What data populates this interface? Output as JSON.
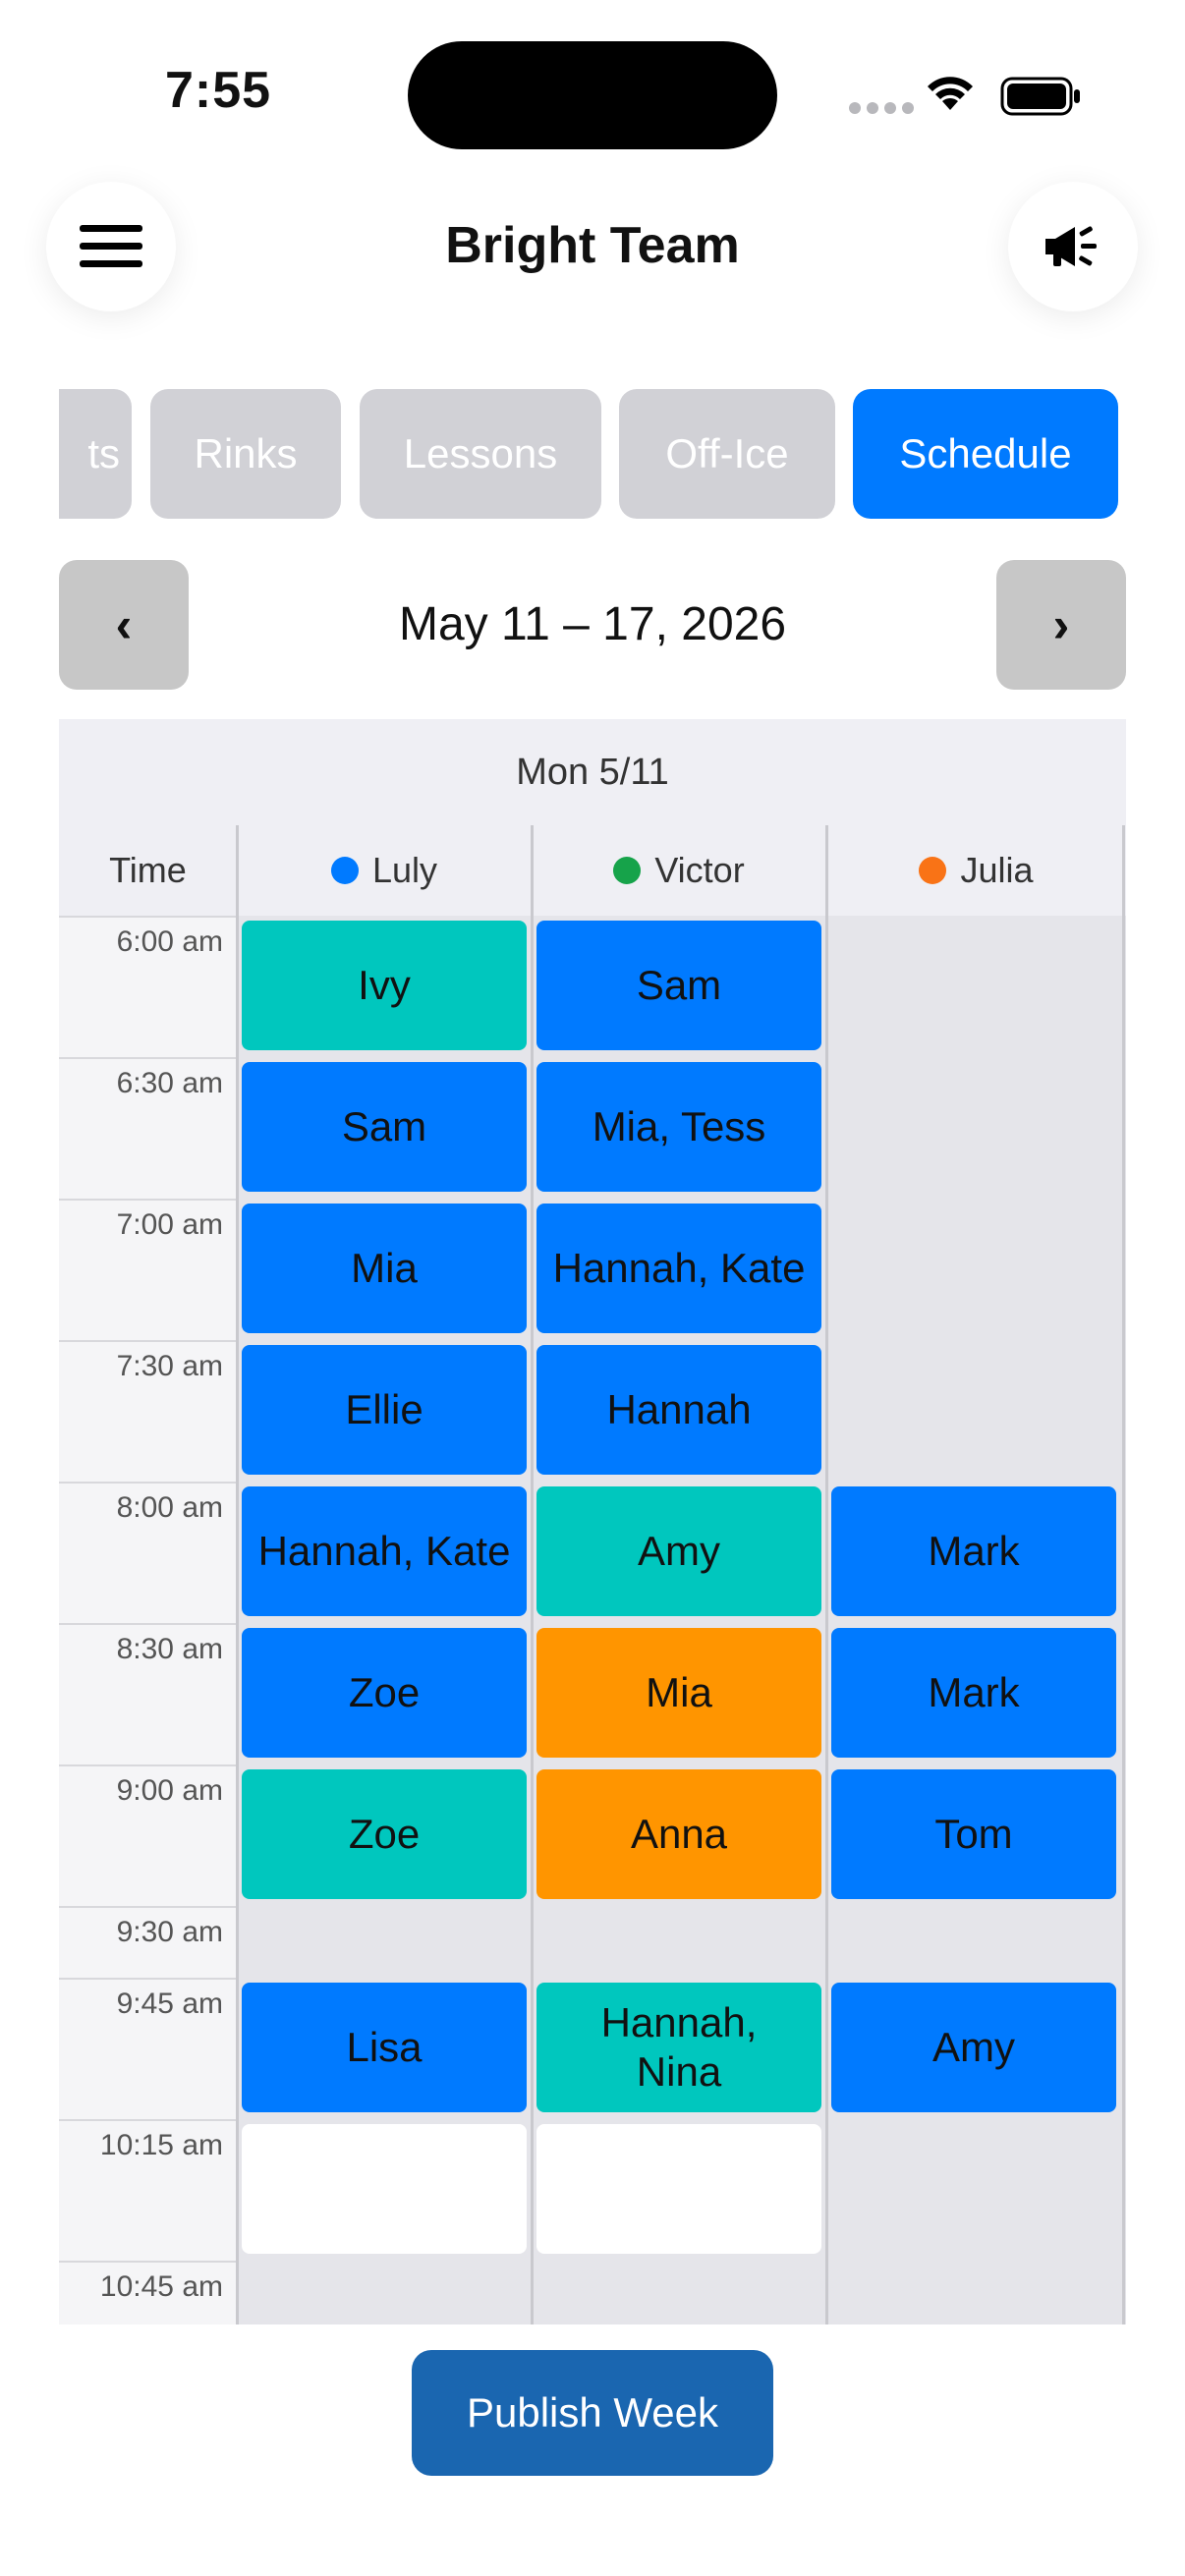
{
  "status_bar": {
    "time": "7:55"
  },
  "header": {
    "title": "Bright Team",
    "menu_icon": "hamburger-icon",
    "announce_icon": "megaphone-icon"
  },
  "tabs": [
    {
      "label": "ts",
      "active": false
    },
    {
      "label": "Rinks",
      "active": false
    },
    {
      "label": "Lessons",
      "active": false
    },
    {
      "label": "Off-Ice",
      "active": false
    },
    {
      "label": "Schedule",
      "active": true
    }
  ],
  "week_nav": {
    "prev_label": "‹",
    "next_label": "›",
    "range": "May 11 – 17, 2026"
  },
  "schedule": {
    "day_label": "Mon 5/11",
    "time_header": "Time",
    "coaches": [
      {
        "name": "Luly",
        "color": "#007aff"
      },
      {
        "name": "Victor",
        "color": "#16a34a"
      },
      {
        "name": "Julia",
        "color": "#f97316"
      }
    ],
    "times": [
      "6:00 am",
      "6:30 am",
      "7:00 am",
      "7:30 am",
      "8:00 am",
      "8:30 am",
      "9:00 am",
      "9:30 am",
      "9:45 am",
      "10:15 am",
      "10:45 am"
    ],
    "rows": [
      {
        "cells": [
          {
            "text": "Ivy",
            "color": "teal"
          },
          {
            "text": "Sam",
            "color": "blue"
          },
          null
        ]
      },
      {
        "cells": [
          {
            "text": "Sam",
            "color": "blue"
          },
          {
            "text": "Mia, Tess",
            "color": "blue"
          },
          null
        ]
      },
      {
        "cells": [
          {
            "text": "Mia",
            "color": "blue"
          },
          {
            "text": "Hannah, Kate",
            "color": "blue"
          },
          null
        ]
      },
      {
        "cells": [
          {
            "text": "Ellie",
            "color": "blue"
          },
          {
            "text": "Hannah",
            "color": "blue"
          },
          null
        ]
      },
      {
        "cells": [
          {
            "text": "Hannah, Kate",
            "color": "blue"
          },
          {
            "text": "Amy",
            "color": "teal"
          },
          {
            "text": "Mark",
            "color": "blue"
          }
        ]
      },
      {
        "cells": [
          {
            "text": "Zoe",
            "color": "blue"
          },
          {
            "text": "Mia",
            "color": "orange"
          },
          {
            "text": "Mark",
            "color": "blue"
          }
        ]
      },
      {
        "cells": [
          {
            "text": "Zoe",
            "color": "teal"
          },
          {
            "text": "Anna",
            "color": "orange"
          },
          {
            "text": "Tom",
            "color": "blue"
          }
        ]
      },
      {
        "cells": [
          null,
          null,
          null
        ]
      },
      {
        "cells": [
          {
            "text": "Lisa",
            "color": "blue"
          },
          {
            "text": "Hannah,\nNina",
            "color": "teal"
          },
          {
            "text": "Amy",
            "color": "blue"
          }
        ]
      },
      {
        "cells": [
          {
            "text": "",
            "color": "empty"
          },
          {
            "text": "",
            "color": "empty"
          },
          null
        ]
      },
      {
        "cells": [
          null,
          null,
          null
        ]
      }
    ]
  },
  "publish_label": "Publish Week"
}
